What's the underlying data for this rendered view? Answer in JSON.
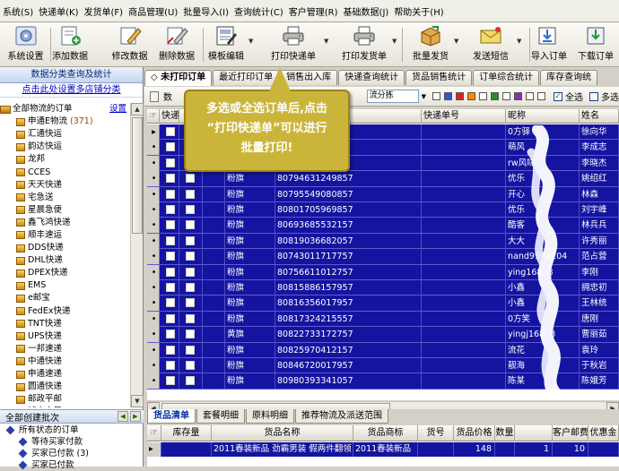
{
  "menu": [
    "系统(S)",
    "快递单(K)",
    "发货单(F)",
    "商品管理(U)",
    "批量导入(I)",
    "查询统计(C)",
    "客户管理(R)",
    "基础数据(J)",
    "帮助关于(H)"
  ],
  "toolbar": {
    "buttons": [
      {
        "label": "系统设置",
        "icon": "gear-icon"
      },
      {
        "label": "添加数据",
        "icon": "add-document-icon"
      },
      {
        "label": "修改数据",
        "icon": "edit-pencil-icon"
      },
      {
        "label": "删除数据",
        "icon": "delete-pencil-icon"
      },
      {
        "label": "模板编辑",
        "icon": "template-edit-icon"
      },
      {
        "label": "打印快递单",
        "icon": "printer-icon"
      },
      {
        "label": "打印发货单",
        "icon": "printer-icon"
      },
      {
        "label": "批量发货",
        "icon": "shipping-box-icon"
      },
      {
        "label": "发送短信",
        "icon": "envelope-icon"
      },
      {
        "label": "导入订单",
        "icon": "import-icon"
      },
      {
        "label": "下载订单",
        "icon": "download-icon"
      }
    ]
  },
  "left": {
    "header": "数据分类查询及统计",
    "link": "点击此处设置多店铺分类",
    "tree_root": {
      "label": "全部物流的订单",
      "settings": "设置"
    },
    "tree_items": [
      {
        "label": "申通E物流",
        "count": "(371)"
      },
      {
        "label": "汇通快运",
        "count": ""
      },
      {
        "label": "韵达快运",
        "count": ""
      },
      {
        "label": "龙邦",
        "count": ""
      },
      {
        "label": "CCES",
        "count": ""
      },
      {
        "label": "天天快递",
        "count": ""
      },
      {
        "label": "宅急送",
        "count": ""
      },
      {
        "label": "星晨急便",
        "count": ""
      },
      {
        "label": "鑫飞鸿快递",
        "count": ""
      },
      {
        "label": "顺丰速运",
        "count": ""
      },
      {
        "label": "DDS快递",
        "count": ""
      },
      {
        "label": "DHL快递",
        "count": ""
      },
      {
        "label": "DPEX快递",
        "count": ""
      },
      {
        "label": "EMS",
        "count": ""
      },
      {
        "label": "e邮宝",
        "count": ""
      },
      {
        "label": "FedEx快递",
        "count": ""
      },
      {
        "label": "TNT快递",
        "count": ""
      },
      {
        "label": "UPS快递",
        "count": ""
      },
      {
        "label": "一邦速递",
        "count": ""
      },
      {
        "label": "中通快递",
        "count": ""
      },
      {
        "label": "申通速递",
        "count": ""
      },
      {
        "label": "圆通快递",
        "count": ""
      },
      {
        "label": "邮政平邮",
        "count": ""
      },
      {
        "label": "城市之星",
        "count": ""
      }
    ],
    "batch_header": "全部创建批次",
    "status_tree": [
      {
        "label": "所有状态的订单"
      },
      {
        "label": "等待买家付款"
      },
      {
        "label": "买家已付款 (3)"
      },
      {
        "label": "买家已付款"
      }
    ]
  },
  "tabs": [
    "未打印订单",
    "最近打印订单",
    "销售出入库",
    "快递查询统计",
    "货品销售统计",
    "订单综合统计",
    "库存查询统"
  ],
  "filterbar": {
    "label": "数",
    "dropdown": "流分拣",
    "select_all": "全选",
    "multi_select": "多选",
    "flag_colors": [
      "#ffffff",
      "#3355cc",
      "#dd2222",
      "#ff8800",
      "#ffffff",
      "#2a8a2a",
      "#ffffff",
      "#8833aa",
      "#ffffff",
      "#ffffff"
    ]
  },
  "grid": {
    "columns": [
      "快递",
      "",
      "",
      "",
      "快递单号",
      "昵称",
      "姓名"
    ],
    "rows": [
      {
        "store": "",
        "tracking": "",
        "nick": "0方驿",
        "name": "徐向华"
      },
      {
        "store": "",
        "tracking": "",
        "nick": "萌风",
        "name": "李成志"
      },
      {
        "store": "",
        "tracking": "",
        "nick": "rw风味",
        "name": "李晓杰"
      },
      {
        "store": "粉旗",
        "tracking": "80794631249857",
        "nick": "优乐",
        "name": "姚绍红"
      },
      {
        "store": "粉旗",
        "tracking": "80795549080857",
        "nick": "开心",
        "name": "林森"
      },
      {
        "store": "粉旗",
        "tracking": "80801705969857",
        "nick": "优乐",
        "name": "刘宇峰"
      },
      {
        "store": "粉旗",
        "tracking": "80693685532157",
        "nick": "酷客",
        "name": "林兵兵"
      },
      {
        "store": "粉旗",
        "tracking": "80819036682057",
        "nick": "大大",
        "name": "许秀丽"
      },
      {
        "store": "粉旗",
        "tracking": "80743011717757",
        "nick": "nand9901104",
        "name": "范占营"
      },
      {
        "store": "粉旗",
        "tracking": "80756611012757",
        "nick": "ying16888",
        "name": "李刚"
      },
      {
        "store": "粉旗",
        "tracking": "80815886157957",
        "nick": "小鑫",
        "name": "拥忠初"
      },
      {
        "store": "粉旗",
        "tracking": "80816356017957",
        "nick": "小鑫",
        "name": "王林统"
      },
      {
        "store": "粉旗",
        "tracking": "80817324215557",
        "nick": "0方笑",
        "name": "唐刚"
      },
      {
        "store": "黄旗",
        "tracking": "80822733172757",
        "nick": "yingj16888",
        "name": "曹丽茹"
      },
      {
        "store": "粉旗",
        "tracking": "80825970412157",
        "nick": "流花",
        "name": "袁玲"
      },
      {
        "store": "粉旗",
        "tracking": "80846720017957",
        "nick": "靓海",
        "name": "于秋岩"
      },
      {
        "store": "粉旗",
        "tracking": "80980393341057",
        "nick": "陈某",
        "name": "陈娥芳"
      }
    ]
  },
  "bottom_tabs": [
    "货品清单",
    "套餐明细",
    "原料明细",
    "推荐物流及派送范围"
  ],
  "bottom_grid": {
    "columns": [
      "库存量",
      "货品名称",
      "货品商标",
      "货号",
      "货品价格",
      "数量",
      "客户邮费",
      "优惠金"
    ],
    "row": {
      "stock": "",
      "name": "2011春装新品 劲霸男装 假两件翻领",
      "brand": "2011春装新品",
      "sku": "",
      "price": "148",
      "qty": "1",
      "postage": "10",
      "discount": ""
    }
  },
  "callout": {
    "line1": "多选或全选订单后,点击",
    "line2": "“打印快递单”可以进行",
    "line3": "批量打印!"
  },
  "colors": {
    "row_selected": "#1414a0",
    "callout_bg": "#cbb43a",
    "link": "#0000cc"
  }
}
